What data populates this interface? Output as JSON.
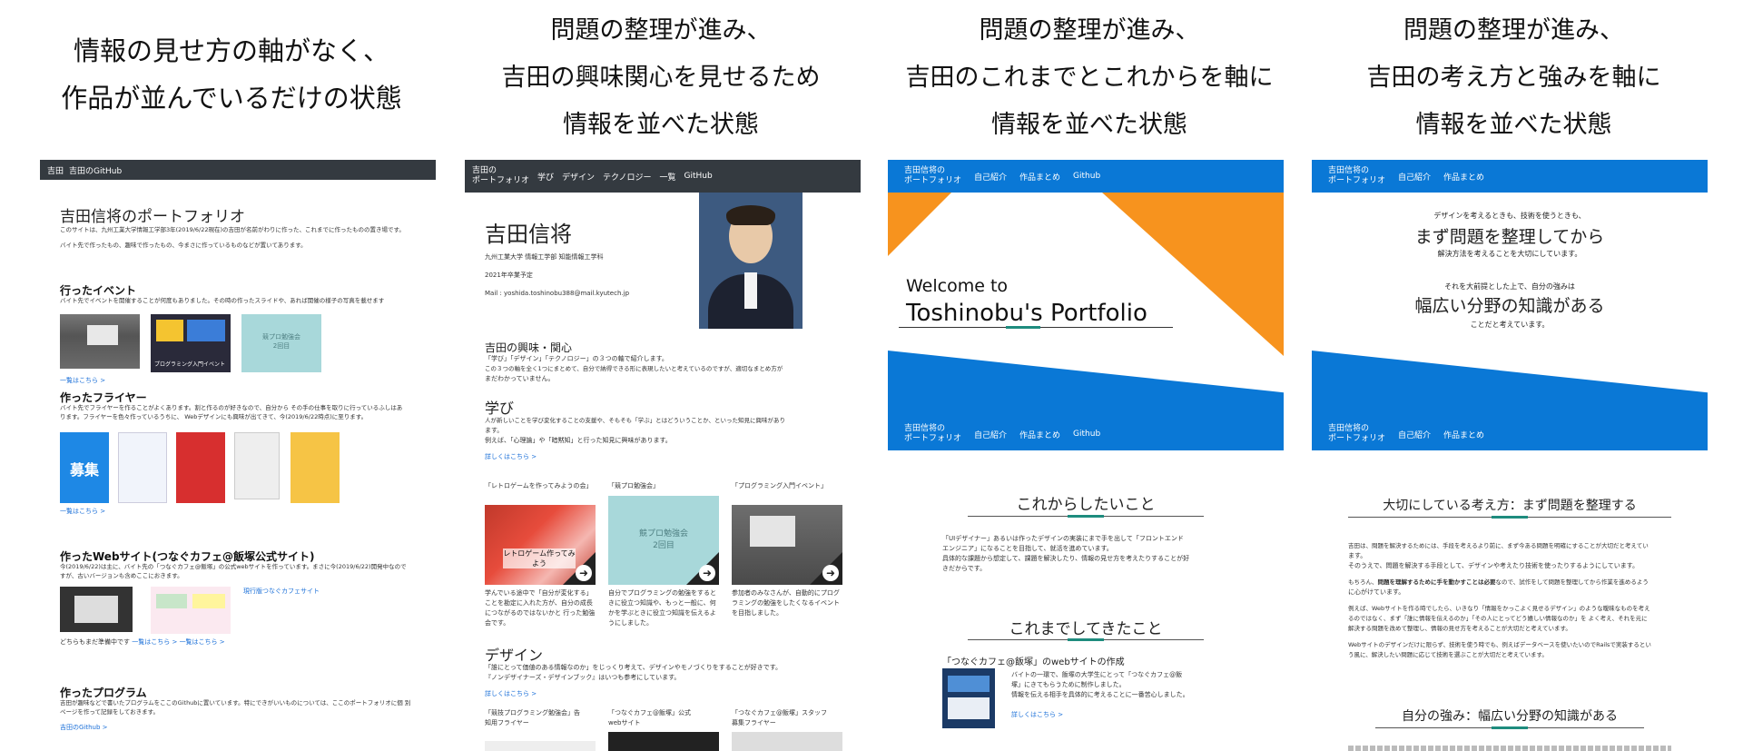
{
  "panels": [
    {
      "caption": [
        "情報の見せ方の軸がなく、",
        "作品が並んでいるだけの状態"
      ],
      "nav": {
        "items": [
          "吉田",
          "吉田のGitHub"
        ]
      },
      "title": "吉田信将のポートフォリオ",
      "intro": [
        "このサイトは、九州工業大学情報工学部3年(2019/6/22現在)の吉田が名前がわりに作った、これまでに作ったものの置き場です。",
        "バイト先で作ったもの、趣味で作ったもの、今まさに作っているものなどが置いてあります。"
      ],
      "s1": {
        "title": "行ったイベント",
        "desc": "バイト先でイベントを開催することが何度もありました。その時の作ったスライドや、あれば開催の様子の写真を載せます",
        "thumb2": "プログラミング入門イベント",
        "thumb3": [
          "競プロ勉強会",
          "2回目"
        ],
        "more": "一覧はこちら >"
      },
      "s2": {
        "title": "作ったフライヤー",
        "desc": "バイト先でフライヤーを作ることがよくあります。割と作るのが好きなので、自分から その手の仕事を取りに行っているふしはあります。フライヤーを色々作っているうちに、 Webデザインにも興味が出てきて、今(2019/6/22時点)に至ります。",
        "flyer1": "募集",
        "more": "一覧はこちら >"
      },
      "s3": {
        "title": "作ったWebサイト(つなぐカフェ@飯塚公式サイト)",
        "desc": "今(2019/6/22)は主に、バイト先の「つなぐカフェ@飯塚」の公式webサイトを作っています。まさに今(2019/6/22)開発中なので すが、古いバージョンも含めここにおきます。",
        "link": "現行版つなぐカフェサイト",
        "foot": "どちらもまだ準備中です",
        "more1": "一覧はこちら >",
        "more2": "一覧はこちら >"
      },
      "s4": {
        "title": "作ったプログラム",
        "desc": "吉田が趣味などで書いたプログラムをここのGithubに置いています。特にできがいいものについては、ここのポートフォリオに個 別ページを作って記録をしておきます。",
        "more": "吉田のGithub >"
      }
    },
    {
      "caption": [
        "問題の整理が進み、",
        "吉田の興味関心を見せるため",
        "情報を並べた状態"
      ],
      "nav": {
        "brand": [
          "吉田の",
          "ポートフォリオ"
        ],
        "items": [
          "学び",
          "デザイン",
          "テクノロジー",
          "一覧",
          "GitHub"
        ]
      },
      "name": "吉田信将",
      "info": [
        "九州工業大学 情報工学部 知能情報工学科",
        "2021年卒業予定",
        "Mail : yoshida.toshinobu388@mail.kyutech.jp"
      ],
      "interest": {
        "title": "吉田の興味・関心",
        "text": [
          "「学び」「デザイン」「テクノロジー」の３つの軸で紹介します。",
          "この３つの軸を全く1つにまとめて、自分で納得できる形に表現したいと考えているのですが、適切なまとめ方が",
          "まだわかっていません。"
        ]
      },
      "learn": {
        "title": "学び",
        "text": [
          "人が新しいことを学び変化することの支援や、そもそも「学ぶ」とはどういうことか、といった知見に興味があり",
          "ます。",
          "例えば、「心理論」や「暗黙知」と行った知見に興味があります。"
        ],
        "more": "詳しくはこちら >"
      },
      "cards": [
        {
          "title": "「レトロゲームを作ってみようの会」",
          "img": "レトロゲーム作ってみよう",
          "desc": "学んでいる途中で「自分が変化する」ことを勘定に入れた方が、自分の成長につながるのではないかと 行った勉強会です。"
        },
        {
          "title": "「競プロ勉強会」",
          "img": [
            "競プロ勉強会",
            "2回目"
          ],
          "desc": "自分でプログラミングの勉強をするときに役立つ知識や、もっと一般に、何かを学ぶときに役立つ知識を伝えるようにしました。"
        },
        {
          "title": "「プログラミング入門イベント」",
          "desc": "参加者のみなさんが、自動的にプログラミングの勉強をしたくなるイベントを目指しました。"
        }
      ],
      "design": {
        "title": "デザイン",
        "text": [
          "「誰にとって価値のある情報なのか」をじっくり考えて、デザインやモノづくりをすることが好きです。",
          "『ノンデザイナーズ・デザインブック』はいつも参考にしています。"
        ],
        "more": "詳しくはこちら >",
        "cards": [
          "「競技プログラミング勉強会」告知用フライヤー",
          "「つなぐカフェ@飯塚」公式webサイト",
          "「つなぐカフェ@飯塚」スタッフ募集フライヤー"
        ]
      }
    },
    {
      "caption": [
        "問題の整理が進み、",
        "吉田のこれまでとこれからを軸に",
        "情報を並べた状態"
      ],
      "nav": {
        "brand": [
          "吉田信将の",
          "ポートフォリオ"
        ],
        "items": [
          "自己紹介",
          "作品まとめ",
          "Github"
        ]
      },
      "hero": {
        "line1": "Welcome to",
        "line2": "Toshinobu's  Portfolio"
      },
      "future": {
        "title": "これからしたいこと",
        "text": [
          "「UIデザイナー」あるいは作ったデザインの実装にまで手を出して「フロントエンド",
          "エンジニア」になることを目指して、就活を進めています。",
          "具体的な課題から想定して、課題を解決したり、情報の見せ方を考えたりすることが好",
          "きだからです。"
        ]
      },
      "past": {
        "title": "これまでしてきたこと",
        "item": "「つなぐカフェ@飯塚」のwebサイトの作成",
        "text": [
          "バイトの一環で、飯塚の大学生にとって「つなぐカフェ@飯",
          "塚」にきてもらうために制作しました。",
          "情報を伝える相手を具体的に考えることに一番苦心しました。"
        ],
        "more": "詳しくはこちら >"
      }
    },
    {
      "caption": [
        "問題の整理が進み、",
        "吉田の考え方と強みを軸に",
        "情報を並べた状態"
      ],
      "nav": {
        "brand": [
          "吉田信将の",
          "ポートフォリオ"
        ],
        "items": [
          "自己紹介",
          "作品まとめ"
        ]
      },
      "hero": {
        "l1": "デザインを考えるときも、技術を使うときも、",
        "l2": "まず問題を整理してから",
        "l3": "解決方法を考えることを大切にしています。",
        "l4": "それを大前提とした上で、自分の強みは",
        "l5": "幅広い分野の知識がある",
        "l6": "ことだと考えています。"
      },
      "sec1": {
        "title": "大切にしている考え方：まず問題を整理する",
        "p1": [
          "吉田は、問題を解決するためには、手段を考えるより前に、まず今ある問題を明確にすることが大切だと考えてい",
          "ます。",
          "そのうえで、問題を解決する手段として、デザインや考えたり技術を使ったりするようにしています。"
        ],
        "p2_pre": "もちろん、",
        "p2_bold": "問題を理解するために手を動かすことは必要",
        "p2_post": "なので、試作をして問題を整理してから作業を進めるよう",
        "p2_2": "に心がけています。",
        "p3": [
          "例えば、Webサイトを作る時でしたら、いきなり「情報をかっこよく見せるデザイン」のような曖昧なものを考え",
          "るのではなく、まず「誰に情報を伝えるのか」「その人にとってどう嬉しい情報なのか」を よく考え、それを元に",
          "解決する問題を改めて整理し、情報の見せ方を考えることが大切だと考えています。"
        ],
        "p4": [
          "Webサイトのデザインだけに限らず、技術を使う時でも、例えばデータベースを使いたいのでRailsで実装するとい",
          "う風に、解決したい問題に応じて技術を選ぶことが大切だと考えています。"
        ]
      },
      "sec2": {
        "title": "自分の強み：幅広い分野の知識がある"
      }
    }
  ]
}
